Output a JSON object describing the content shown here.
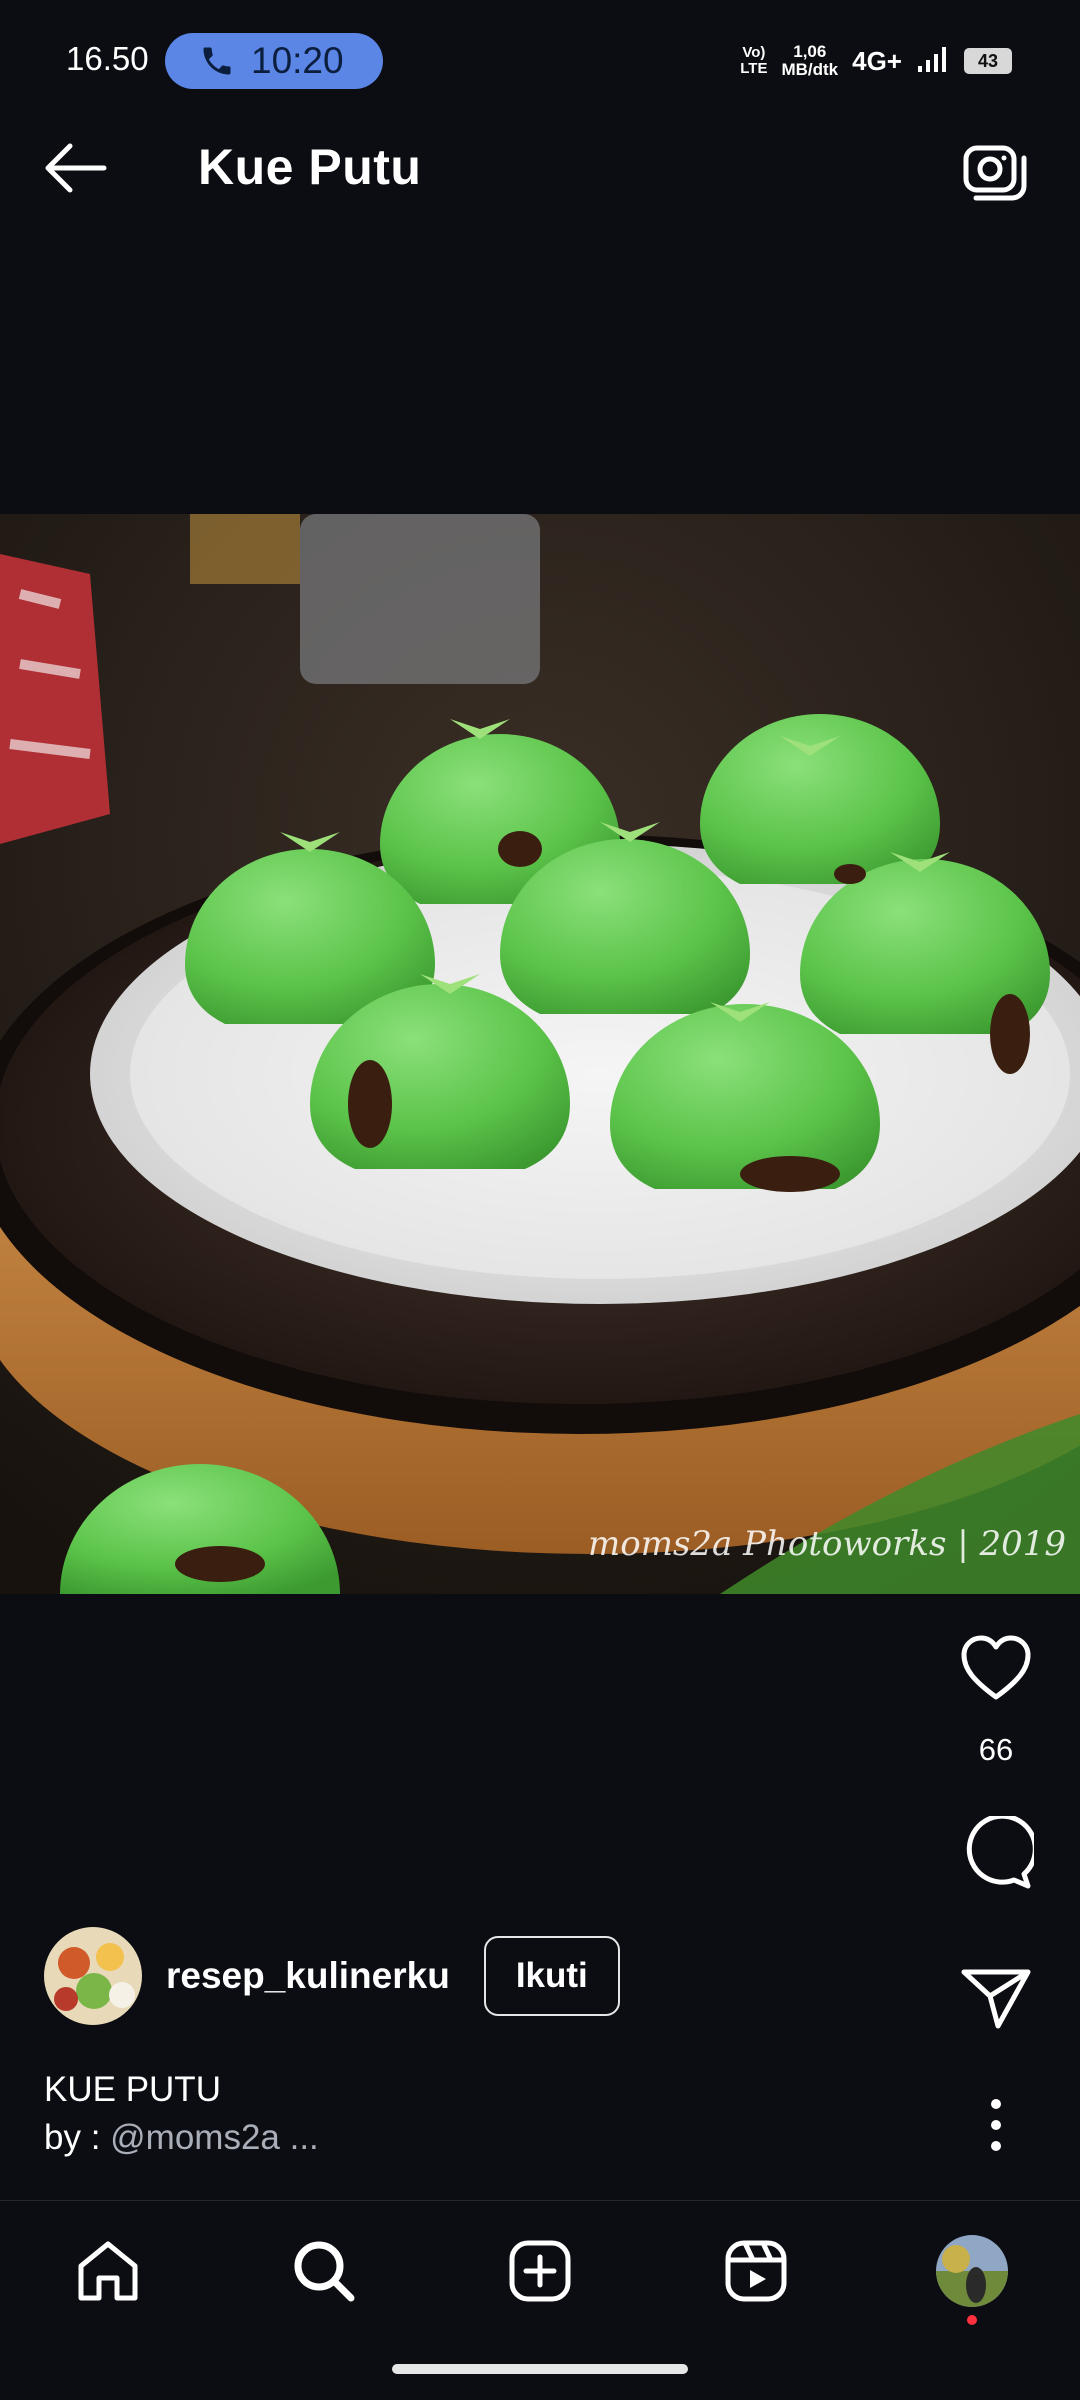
{
  "status_bar": {
    "time": "16.50",
    "call_timer": "10:20",
    "volte_line1": "Vo)",
    "volte_line2": "LTE",
    "speed_line1": "1,06",
    "speed_line2": "MB/dtk",
    "network": "4G+",
    "battery": "43",
    "call_pill_color": "#5b86e6"
  },
  "header": {
    "title": "Kue Putu"
  },
  "post": {
    "watermark": "moms2a Photoworks | 2019",
    "like_count": "66",
    "username": "resep_kulinerku",
    "follow_label": "Ikuti",
    "caption_title": "KUE PUTU",
    "caption_by": "by : ",
    "caption_handle": "@moms2a ..."
  },
  "icons": {
    "back": "arrow-left-icon",
    "camera": "camera-icon",
    "like": "heart-icon",
    "comment": "comment-icon",
    "share": "send-icon",
    "more": "more-vertical-icon",
    "nav": [
      "home-icon",
      "search-icon",
      "create-icon",
      "reels-icon",
      "profile-avatar"
    ]
  },
  "colors": {
    "background": "#0b0d12",
    "notification_dot": "#ff3040"
  }
}
